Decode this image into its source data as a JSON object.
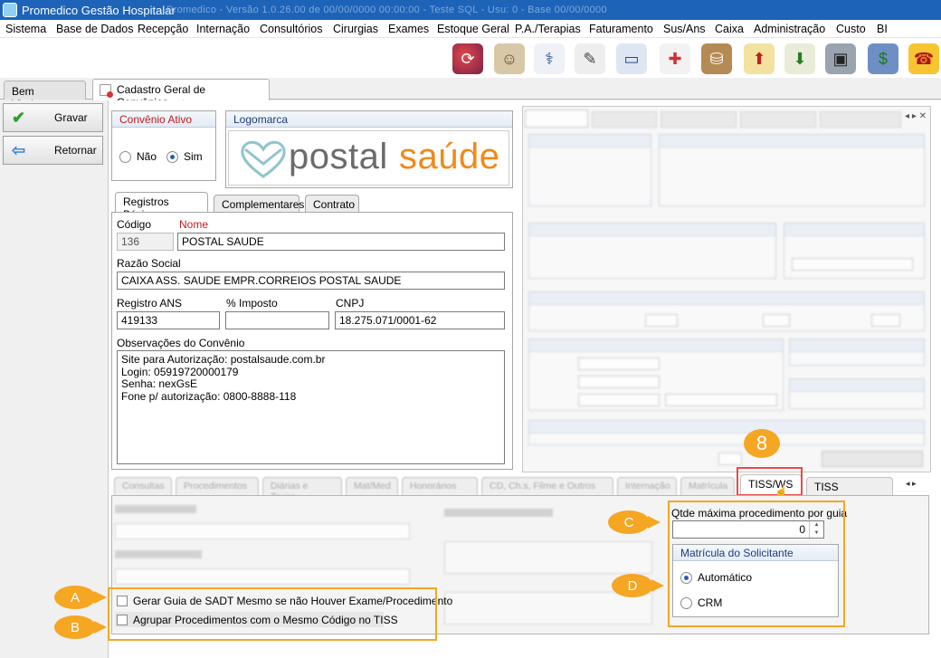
{
  "window": {
    "title": "Promedico Gestão Hospitalar",
    "title_extra": "Promedico - Versão 1.0.26.00 de 00/00/0000 00:00:00 - Teste SQL - Usu: 0 - Base 00/00/0000"
  },
  "menu": [
    "Sistema",
    "Base de Dados",
    "Recepção",
    "Internação",
    "Consultórios",
    "Cirurgias",
    "Exames",
    "Estoque Geral",
    "P.A./Terapias",
    "Faturamento",
    "Sus/Ans",
    "Caixa",
    "Administração",
    "Custo",
    "BI"
  ],
  "toolbar_icons": [
    "refresh-icon",
    "patients-icon",
    "doctor-icon",
    "clipboard-icon",
    "bed-icon",
    "ambulance-icon",
    "medicine-icon",
    "cash-up-icon",
    "cash-down-icon",
    "safe-icon",
    "chart-money-icon",
    "phone-icon"
  ],
  "doc_tabs": [
    {
      "label": "Bem Vindo",
      "active": false
    },
    {
      "label": "Cadastro Geral de Convênios",
      "active": true
    }
  ],
  "side_buttons": {
    "save": "Gravar",
    "back": "Retornar"
  },
  "convenio_ativo": {
    "title": "Convênio Ativo",
    "options": [
      "Não",
      "Sim"
    ],
    "selected": "Sim"
  },
  "logomarca": {
    "title": "Logomarca",
    "brand_a": "postal",
    "brand_b": "saúde"
  },
  "panel_tabs": [
    "Registros Básicos",
    "Complementares",
    "Contrato"
  ],
  "fields": {
    "codigo_label": "Código",
    "codigo_value": "136",
    "nome_label": "Nome",
    "nome_value": "POSTAL SAUDE",
    "razao_label": "Razão Social",
    "razao_value": "CAIXA ASS. SAUDE EMPR.CORREIOS POSTAL SAUDE",
    "ans_label": "Registro ANS",
    "ans_value": "419133",
    "imposto_label": "% Imposto",
    "imposto_value": "",
    "cnpj_label": "CNPJ",
    "cnpj_value": "18.275.071/0001-62",
    "obs_label": "Observações do Convênio",
    "obs_lines": [
      "Site para Autorização: postalsaude.com.br",
      "Login: 05919720000179",
      "Senha: nexGsE",
      "Fone p/ autorização: 0800-8888-118"
    ]
  },
  "bottom_tabs": [
    "Consultas",
    "Procedimentos",
    "Diárias e Taxas",
    "Mat/Med",
    "Honorários",
    "CD, Ch.s, Filme e Outros",
    "Internação",
    "Matrícula",
    "TISS/WS",
    "TISS Impressão"
  ],
  "tiss_ws": {
    "qtde_label": "Qtde máxima procedimento por guia",
    "qtde_value": "0",
    "matricula_title": "Matrícula do Solicitante",
    "matricula_options": [
      "Automático",
      "CRM"
    ],
    "matricula_selected": "Automático",
    "check_a": "Gerar Guia de SADT Mesmo se não Houver Exame/Procedimento",
    "check_b": "Agrupar Procedimentos com o Mesmo Código no TISS"
  },
  "callouts": {
    "a": "A",
    "b": "B",
    "c": "C",
    "d": "D",
    "step": "8"
  },
  "colors": {
    "titlebar": "#1d63b8",
    "callout": "#f5a623",
    "highlight": "#e84a4a",
    "group_title": "#1f3c78",
    "brand_gray": "#6b6b6b",
    "brand_orange": "#f08a1c"
  }
}
